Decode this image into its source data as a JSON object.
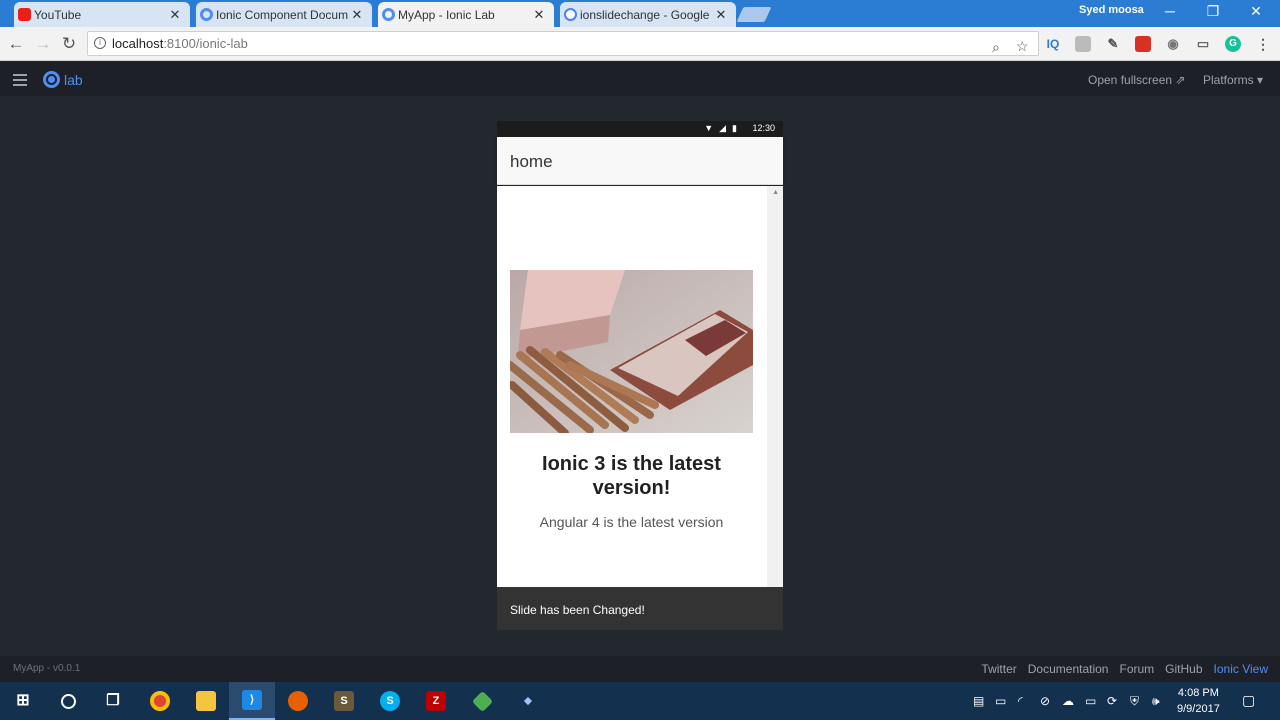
{
  "browser": {
    "tabs": [
      {
        "title": "YouTube",
        "icon": "youtube-icon",
        "active": false
      },
      {
        "title": "Ionic Component Docum",
        "icon": "ionic-icon",
        "active": false
      },
      {
        "title": "MyApp - Ionic Lab",
        "icon": "ionic-icon",
        "active": true
      },
      {
        "title": "ionslidechange - Google",
        "icon": "google-icon",
        "active": false
      }
    ],
    "profile_name": "Syed moosa",
    "url_host": "localhost",
    "url_path": ":8100/ionic-lab"
  },
  "lab": {
    "logo_text": "lab",
    "open_fullscreen": "Open fullscreen",
    "platforms": "Platforms",
    "version": "MyApp - v0.0.1",
    "footer_links": [
      "Twitter",
      "Documentation",
      "Forum",
      "GitHub",
      "Ionic View"
    ]
  },
  "device": {
    "status_time": "12:30",
    "header_title": "home",
    "slide_title": "Ionic 3 is the latest version!",
    "slide_subtitle": "Angular 4 is the latest version",
    "toast_message": "Slide has been Changed!"
  },
  "taskbar": {
    "time": "4:08 PM",
    "date": "9/9/2017"
  }
}
